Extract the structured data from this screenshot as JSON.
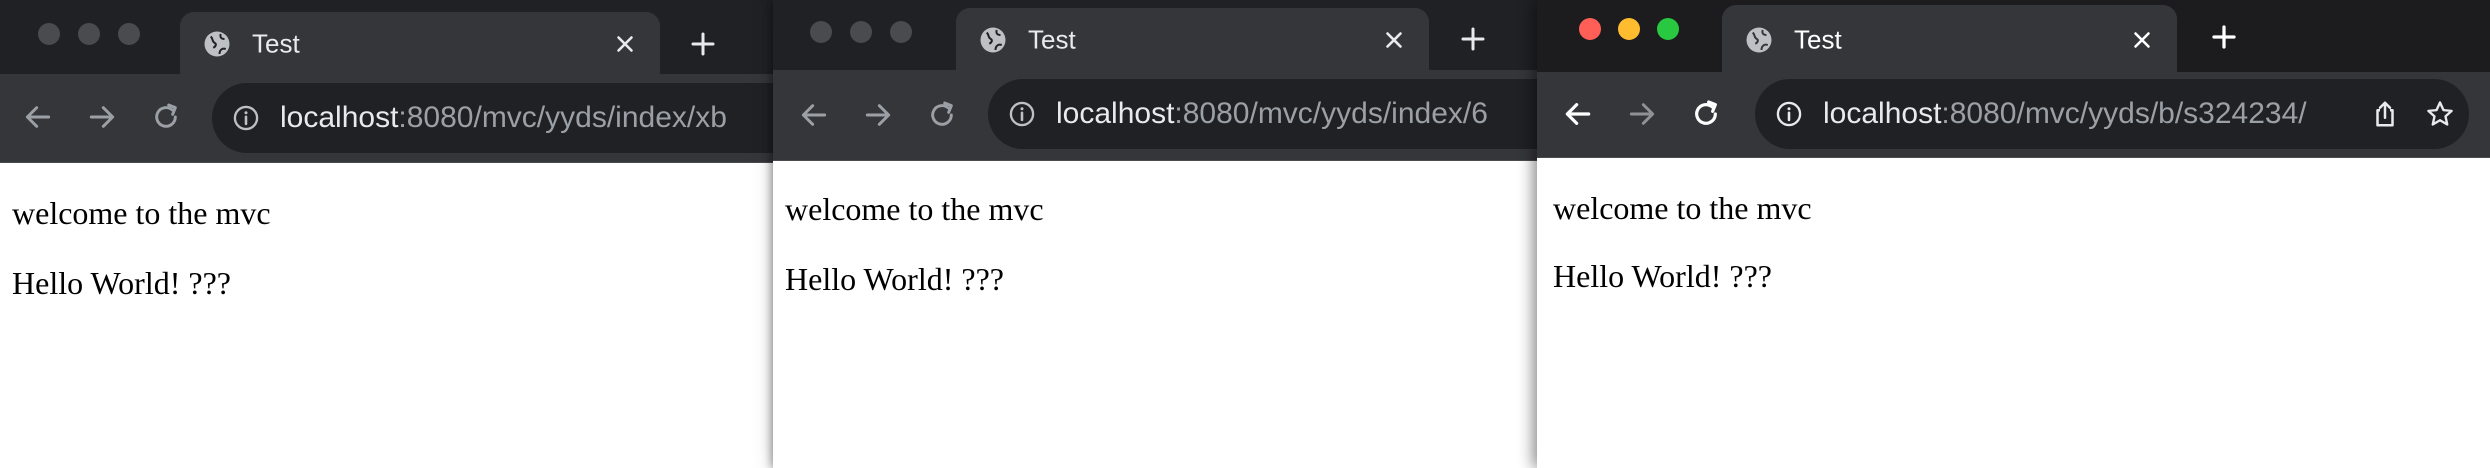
{
  "windows": [
    {
      "tab_title": "Test",
      "url_host": "localhost",
      "url_rest": ":8080/mvc/yyds/index/xb",
      "lines": [
        "welcome to the mvc",
        "Hello World! ???"
      ]
    },
    {
      "tab_title": "Test",
      "url_host": "localhost",
      "url_rest": ":8080/mvc/yyds/index/6",
      "lines": [
        "welcome to the mvc",
        "Hello World! ???"
      ]
    },
    {
      "tab_title": "Test",
      "url_host": "localhost",
      "url_rest": ":8080/mvc/yyds/b/s324234/",
      "lines": [
        "welcome to the mvc",
        "Hello World! ???"
      ]
    }
  ],
  "colors": {
    "titlebar": "#202124",
    "toolbar": "#35363a",
    "traffic_red": "#ff5f57",
    "traffic_yellow": "#febc2e",
    "traffic_green": "#28c840"
  },
  "icons": [
    "globe-icon",
    "close-icon",
    "plus-icon",
    "back-arrow-icon",
    "forward-arrow-icon",
    "reload-icon",
    "info-icon",
    "share-icon",
    "star-icon"
  ]
}
